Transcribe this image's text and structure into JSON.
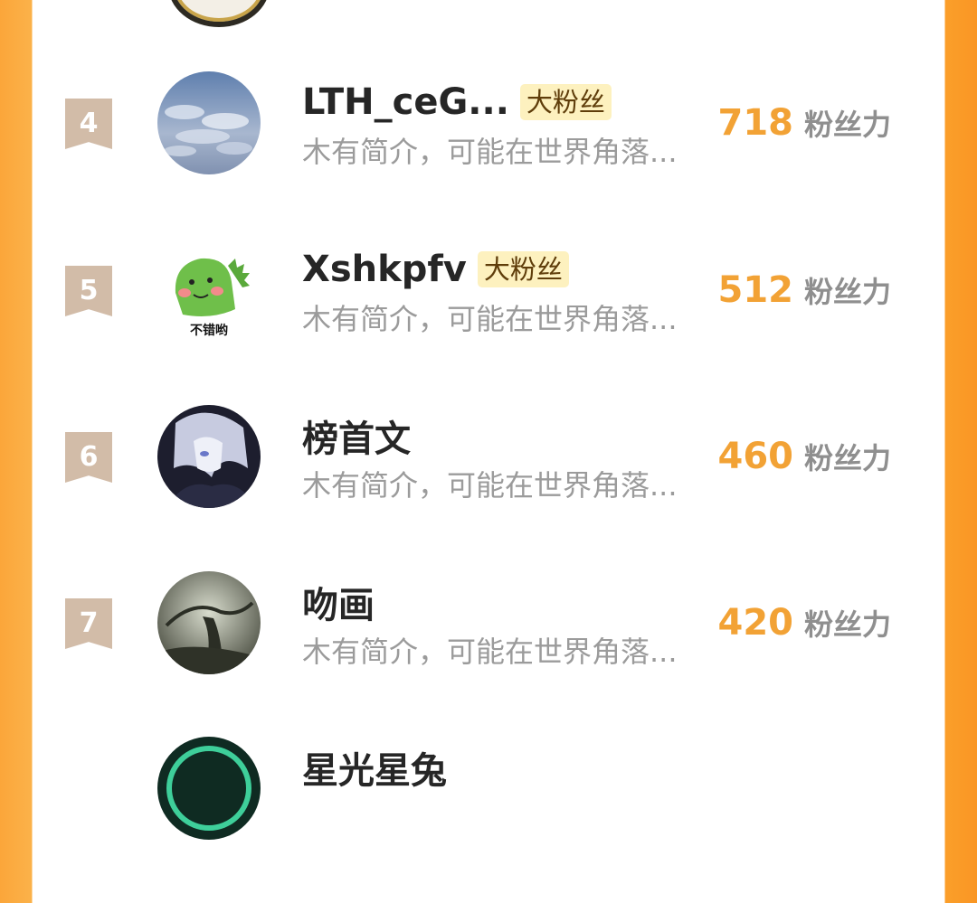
{
  "colors": {
    "accent": "#f2a235",
    "badge_bg": "#fdf1bf",
    "rank_bg": "#d2bca8"
  },
  "ranking": [
    {
      "rank": "4",
      "name": "LTH_ceG...",
      "badge": "大粉丝",
      "bio": "木有简介，可能在世界角落...",
      "score": "718",
      "unit": "粉丝力",
      "avatar": "sky-clouds-avatar"
    },
    {
      "rank": "5",
      "name": "Xshkpfv",
      "badge": "大粉丝",
      "bio": "木有简介，可能在世界角落...",
      "score": "512",
      "unit": "粉丝力",
      "avatar": "green-dinosaur-avatar",
      "avatar_caption": "不错哟"
    },
    {
      "rank": "6",
      "name": "榜首文",
      "bio": "木有简介，可能在世界角落...",
      "score": "460",
      "unit": "粉丝力",
      "avatar": "anime-character-avatar"
    },
    {
      "rank": "7",
      "name": "吻画",
      "bio": "木有简介，可能在世界角落...",
      "score": "420",
      "unit": "粉丝力",
      "avatar": "ink-painting-avatar"
    },
    {
      "name": "星光星兔"
    }
  ]
}
